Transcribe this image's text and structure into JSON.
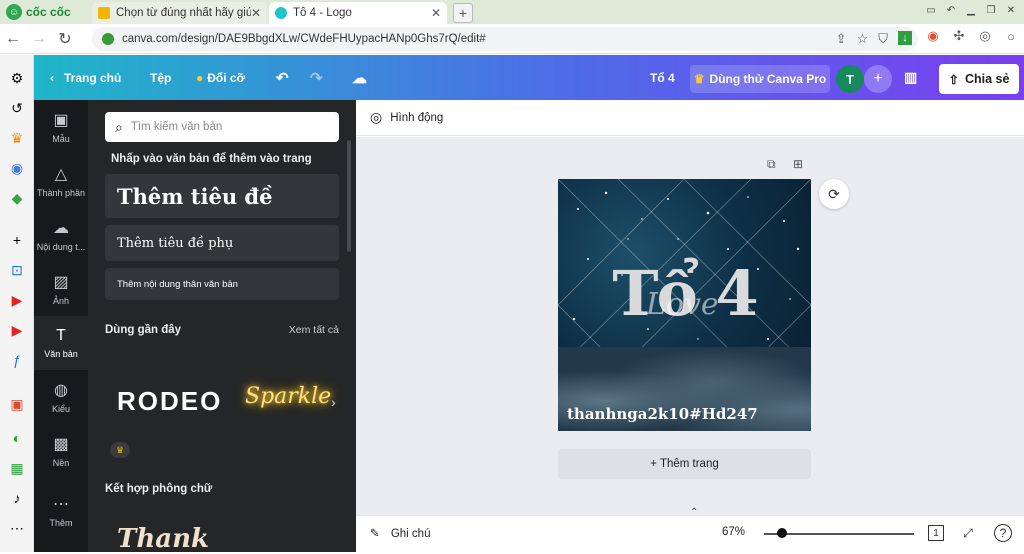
{
  "browser": {
    "brand": "cốc cốc",
    "tabs": [
      {
        "title": "Chọn từ đúng nhất hãy giúp"
      },
      {
        "title": "Tổ 4 - Logo"
      }
    ],
    "url": "canva.com/design/DAE9BbgdXLw/CWdeFHUypacHANp0Ghs7rQ/edit#"
  },
  "topbar": {
    "home": "Trang chủ",
    "file": "Tệp",
    "resize": "Đổi cỡ",
    "doc_title": "Tổ 4",
    "pro": "Dùng thử Canva Pro",
    "avatar_initial": "T",
    "share": "Chia sẻ"
  },
  "rail": [
    {
      "label": "Mẫu"
    },
    {
      "label": "Thành phần"
    },
    {
      "label": "Nội dung t..."
    },
    {
      "label": "Ảnh"
    },
    {
      "label": "Văn bản"
    },
    {
      "label": "Kiểu"
    },
    {
      "label": "Nền"
    },
    {
      "label": "Thêm"
    }
  ],
  "panel": {
    "search_placeholder": "Tìm kiếm văn bản",
    "hint": "Nhấp vào văn bản để thêm vào trang",
    "heading": "Thêm tiêu đề",
    "subheading": "Thêm tiêu đề phụ",
    "body": "Thêm nội dung thân văn bản",
    "recent": "Dùng gần đây",
    "see_all": "Xem tất cả",
    "font1": "RODEO",
    "font2": "Sparkle",
    "combos": "Kết hợp phông chữ",
    "combo1": "Thank"
  },
  "editor": {
    "animate": "Hình động",
    "design_title": "Tổ 4",
    "design_script": "Love",
    "design_credit": "thanhnga2k10#Hd247",
    "add_page": "+ Thêm trang"
  },
  "footer": {
    "notes": "Ghi chú",
    "zoom": "67%",
    "zoom_fraction": 0.12,
    "page_num": "1"
  }
}
